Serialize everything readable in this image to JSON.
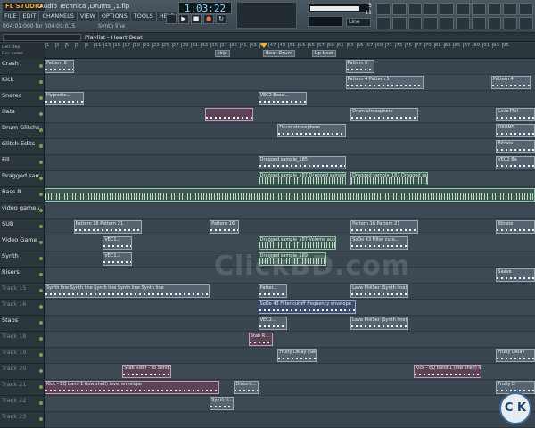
{
  "app": {
    "logo": "FL STUDIO",
    "project_title": "Audio Technica ,Drums_,1.flp",
    "menu": [
      "FILE",
      "EDIT",
      "CHANNELS",
      "VIEW",
      "OPTIONS",
      "TOOLS",
      "HELP"
    ],
    "hint": "004:01:000 for 004:01:015",
    "hint2": "Synth line",
    "time": "1:03:22",
    "line_selector": "Line",
    "counter": "5 11"
  },
  "playlist": {
    "title": "Playlist - Heart Beat",
    "options": [
      "Gen step",
      "Gen nodes"
    ],
    "markers": [
      {
        "label": "skip",
        "bar": 36
      },
      {
        "label": "Beat Drum",
        "bar": 46
      },
      {
        "label": "Up beat",
        "bar": 56
      }
    ],
    "ruler_numbers": [
      "1",
      "3",
      "5",
      "7",
      "9",
      "11",
      "13",
      "15",
      "17",
      "19",
      "21",
      "23",
      "25",
      "27",
      "29",
      "31",
      "33",
      "35",
      "37",
      "39",
      "41",
      "43",
      "45",
      "47",
      "49",
      "51",
      "53",
      "55",
      "57",
      "59",
      "61",
      "63",
      "65",
      "67",
      "69",
      "71",
      "73",
      "75",
      "77",
      "79",
      "81",
      "83",
      "85",
      "87",
      "89",
      "91",
      "93",
      "95"
    ],
    "tracks": [
      "Crash",
      "Kick",
      "Snares",
      "Hats",
      "Drum Glitches",
      "Glitch Edits",
      "Fill",
      "Dragged sampl...",
      "Bass 8",
      "video game arp...",
      "SUB",
      "Video Game Arp",
      "Synth",
      "Risers",
      "Track 15",
      "Track 16",
      "Stabs",
      "Track 18",
      "Track 19",
      "Track 20",
      "Track 21",
      "Track 22",
      "Track 23"
    ],
    "clips": [
      {
        "lane": 0,
        "start": 0,
        "len": 6,
        "type": "pat",
        "label": "Pattern 6"
      },
      {
        "lane": 0,
        "start": 62,
        "len": 6,
        "type": "pat",
        "label": "Pattern 6"
      },
      {
        "lane": 1,
        "start": 62,
        "len": 16,
        "type": "pat",
        "label": "Pattern 4 Pattern 5"
      },
      {
        "lane": 1,
        "start": 92,
        "len": 8,
        "type": "pat",
        "label": "Pattern 4"
      },
      {
        "lane": 2,
        "start": 0,
        "len": 8,
        "type": "pat",
        "label": "Hypnotic..."
      },
      {
        "lane": 2,
        "start": 44,
        "len": 10,
        "type": "pat",
        "label": "VEC2 Bassl..."
      },
      {
        "lane": 3,
        "start": 33,
        "len": 10,
        "type": "pink",
        "label": ""
      },
      {
        "lane": 3,
        "start": 63,
        "len": 14,
        "type": "pat",
        "label": "Drum atmosphere"
      },
      {
        "lane": 3,
        "start": 93,
        "len": 8,
        "type": "pat",
        "label": "Lave Phil"
      },
      {
        "lane": 4,
        "start": 48,
        "len": 14,
        "type": "pat",
        "label": "Drum atmosphere"
      },
      {
        "lane": 4,
        "start": 93,
        "len": 8,
        "type": "pat",
        "label": "DRUMS"
      },
      {
        "lane": 5,
        "start": 93,
        "len": 8,
        "type": "pat",
        "label": "Bitrate"
      },
      {
        "lane": 6,
        "start": 44,
        "len": 18,
        "type": "pat",
        "label": "Dragged sample_185"
      },
      {
        "lane": 6,
        "start": 93,
        "len": 8,
        "type": "pat",
        "label": "VEC2 Ba"
      },
      {
        "lane": 7,
        "start": 44,
        "len": 18,
        "type": "aud",
        "label": "Dragged sample_187 Dragged sample_187"
      },
      {
        "lane": 7,
        "start": 63,
        "len": 16,
        "type": "aud",
        "label": "Dragged sample_187 Dragged sample_185"
      },
      {
        "lane": 8,
        "start": 0,
        "len": 101,
        "type": "aud",
        "label": ""
      },
      {
        "lane": 10,
        "start": 6,
        "len": 14,
        "type": "pat",
        "label": "Pattern 16 Pattern 21"
      },
      {
        "lane": 10,
        "start": 34,
        "len": 6,
        "type": "pat",
        "label": "Pattern 16"
      },
      {
        "lane": 10,
        "start": 63,
        "len": 14,
        "type": "pat",
        "label": "Pattern 16 Pattern 21"
      },
      {
        "lane": 10,
        "start": 93,
        "len": 8,
        "type": "pat",
        "label": "Bitrate"
      },
      {
        "lane": 11,
        "start": 12,
        "len": 6,
        "type": "pat",
        "label": "VEC1..."
      },
      {
        "lane": 11,
        "start": 44,
        "len": 16,
        "type": "aud",
        "label": "Dragged sample_187 Volume auto..."
      },
      {
        "lane": 11,
        "start": 63,
        "len": 12,
        "type": "pat",
        "label": "SoDo 43 Filter cuto..."
      },
      {
        "lane": 12,
        "start": 12,
        "len": 6,
        "type": "pat",
        "label": "VEC1..."
      },
      {
        "lane": 12,
        "start": 44,
        "len": 14,
        "type": "aud",
        "label": "Dragged sample_189"
      },
      {
        "lane": 13,
        "start": 93,
        "len": 8,
        "type": "pat",
        "label": "Saave"
      },
      {
        "lane": 14,
        "start": 0,
        "len": 34,
        "type": "pat",
        "label": "Synth line Synth line Synth line Synth line Synth line"
      },
      {
        "lane": 14,
        "start": 44,
        "len": 6,
        "type": "pat",
        "label": "Patter..."
      },
      {
        "lane": 14,
        "start": 63,
        "len": 12,
        "type": "pat",
        "label": "Lave PhilSer (Synth line)"
      },
      {
        "lane": 15,
        "start": 44,
        "len": 20,
        "type": "auto",
        "label": "SoDo 43 Filter cutoff frequency envelope"
      },
      {
        "lane": 16,
        "start": 63,
        "len": 12,
        "type": "pat",
        "label": "Lave PhilSer (Synth line)"
      },
      {
        "lane": 16,
        "start": 44,
        "len": 6,
        "type": "pat",
        "label": "VEC2..."
      },
      {
        "lane": 17,
        "start": 42,
        "len": 5,
        "type": "pink",
        "label": "Stab R..."
      },
      {
        "lane": 18,
        "start": 48,
        "len": 8,
        "type": "pat",
        "label": "Fruity Delay (Sen..."
      },
      {
        "lane": 18,
        "start": 93,
        "len": 8,
        "type": "pat",
        "label": "Fruity Delay"
      },
      {
        "lane": 19,
        "start": 16,
        "len": 10,
        "type": "pink",
        "label": "Stab Riser - To Send..."
      },
      {
        "lane": 19,
        "start": 76,
        "len": 14,
        "type": "pink",
        "label": "Kick - EQ band 1 (low shelf) level envelope"
      },
      {
        "lane": 20,
        "start": 0,
        "len": 36,
        "type": "pink",
        "label": "Kick - EQ band 1 (low shelf) level envelope"
      },
      {
        "lane": 20,
        "start": 39,
        "len": 5,
        "type": "pat",
        "label": "Distorti..."
      },
      {
        "lane": 20,
        "start": 93,
        "len": 8,
        "type": "pat",
        "label": "Fruity D"
      },
      {
        "lane": 21,
        "start": 34,
        "len": 5,
        "type": "pat",
        "label": "Synth li..."
      }
    ]
  },
  "watermark": "ClickBD.com",
  "corner_logo": "C K",
  "colors": {
    "accent": "#f4b63a",
    "time_display": "#7fd7ff"
  }
}
